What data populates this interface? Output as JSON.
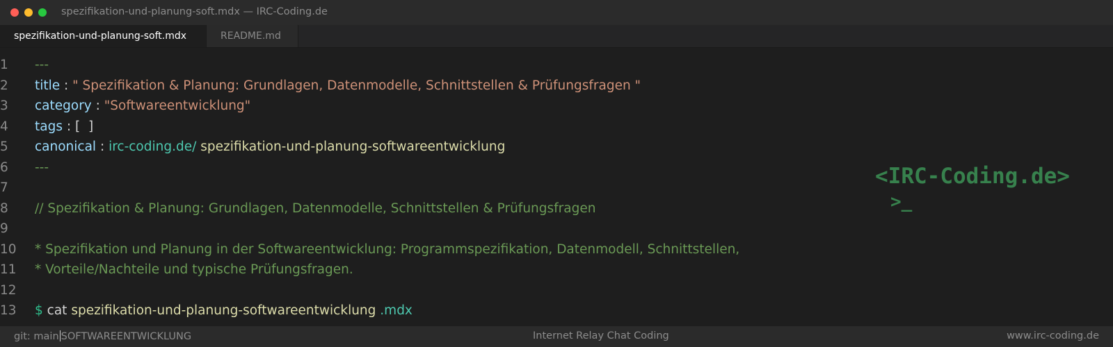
{
  "window": {
    "title": "spezifikation-und-planung-soft.mdx — IRC-Coding.de"
  },
  "tabs": [
    {
      "label": "spezifikation-und-planung-soft.mdx",
      "active": true
    },
    {
      "label": "README.md",
      "active": false
    }
  ],
  "editor": {
    "lines": [
      {
        "number": "1",
        "tokens": {
          "dashes": "---"
        }
      },
      {
        "number": "2",
        "tokens": {
          "key": "title",
          "colon": " : ",
          "value": "\" Spezifikation & Planung: Grundlagen, Datenmodelle, Schnittstellen & Prüfungsfragen \""
        }
      },
      {
        "number": "3",
        "tokens": {
          "key": "category",
          "colon": " : ",
          "value": "\"Softwareentwicklung\""
        }
      },
      {
        "number": "4",
        "tokens": {
          "key": "tags",
          "colon": " : ",
          "value": "[  ]"
        }
      },
      {
        "number": "5",
        "tokens": {
          "key": "canonical",
          "colon": " : ",
          "domain": "irc-coding.de/",
          "path": " spezifikation-und-planung-softwareentwicklung"
        }
      },
      {
        "number": "6",
        "tokens": {
          "dashes": "---"
        }
      },
      {
        "number": "7",
        "tokens": {}
      },
      {
        "number": "8",
        "tokens": {
          "comment": "// Spezifikation & Planung: Grundlagen, Datenmodelle, Schnittstellen & Prüfungsfragen"
        }
      },
      {
        "number": "9",
        "tokens": {}
      },
      {
        "number": "10",
        "tokens": {
          "comment": "* Spezifikation und Planung in der Softwareentwicklung: Programmspezifikation, Datenmodell, Schnittstellen,"
        }
      },
      {
        "number": "11",
        "tokens": {
          "comment": "* Vorteile/Nachteile und typische Prüfungsfragen."
        }
      },
      {
        "number": "12",
        "tokens": {}
      },
      {
        "number": "13",
        "tokens": {
          "prompt": "$",
          "cmd": " cat ",
          "file": "spezifikation-und-planung-softwareentwicklung",
          "ext": " .mdx"
        }
      }
    ]
  },
  "logo": {
    "line1": "<IRC-Coding.de>",
    "line2": ">_"
  },
  "statusbar": {
    "git": "git: main",
    "category": "SOFTWAREENTWICKLUNG",
    "center": "Internet Relay Chat Coding",
    "right": "www.irc-coding.de"
  },
  "colors": {
    "background": "#1e1e1e",
    "comment": "#6a9955",
    "key": "#9cdcfe",
    "string": "#ce9178",
    "teal": "#4ec9b0",
    "yellow": "#dcdcaa",
    "logo": "#37814d"
  }
}
